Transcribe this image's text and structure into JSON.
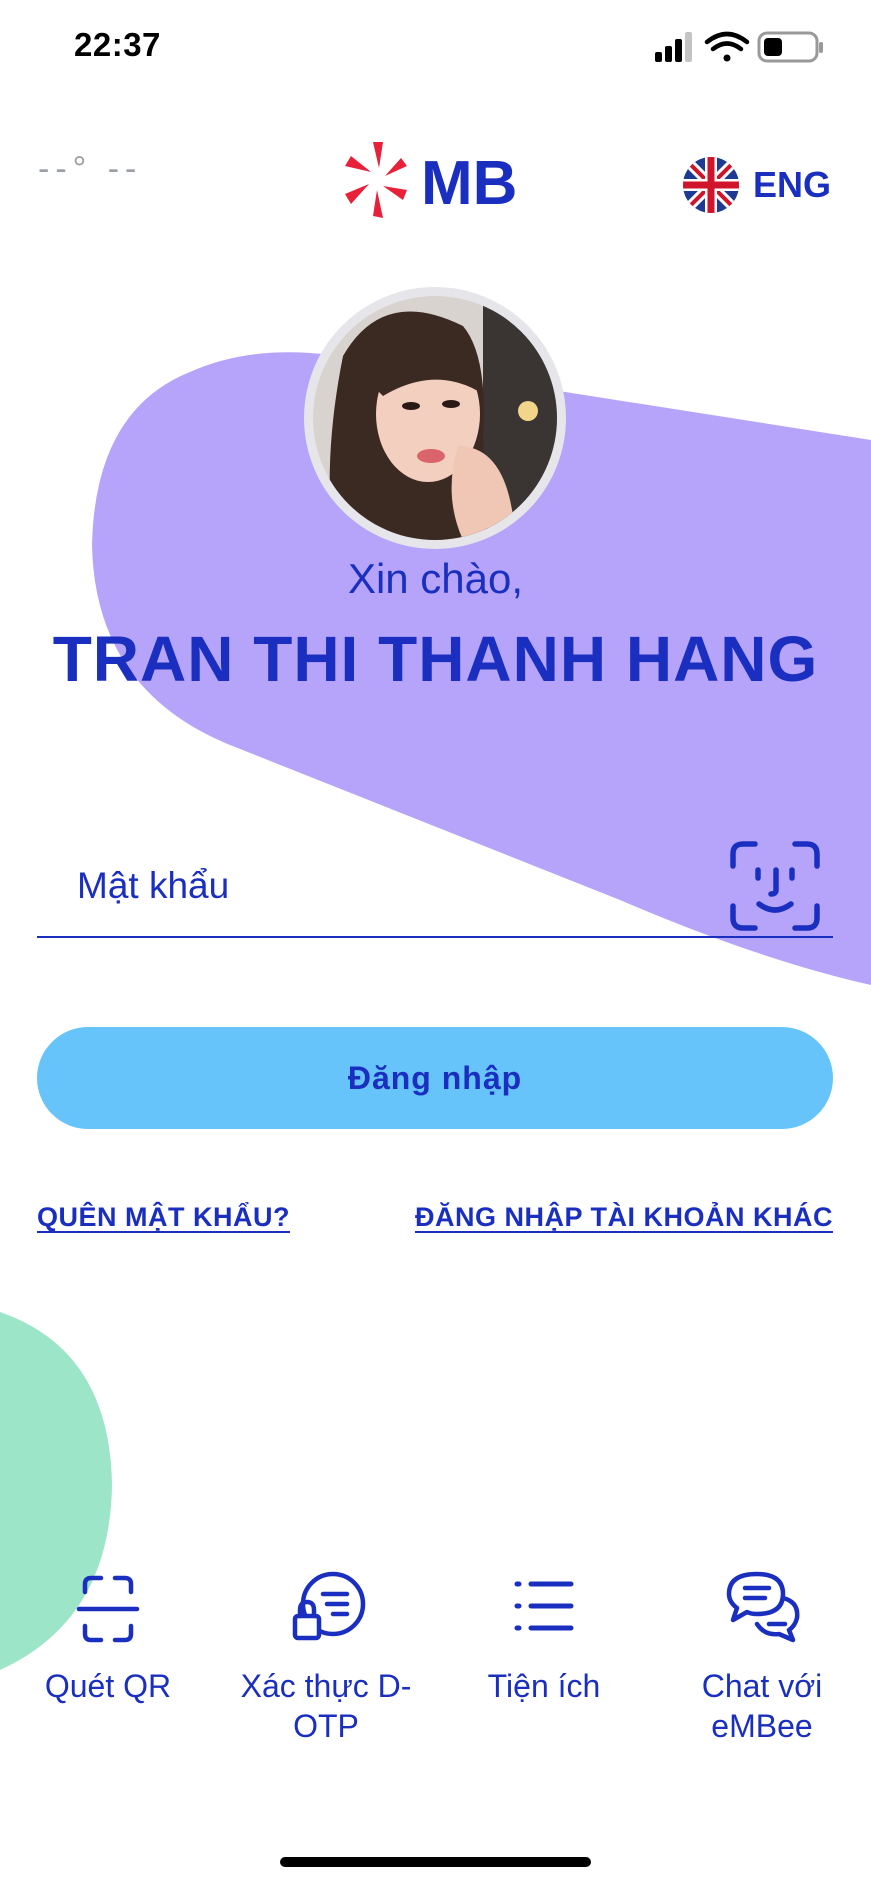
{
  "status_bar": {
    "time": "22:37"
  },
  "header": {
    "weather": "--°  --",
    "logo_text": "MB",
    "language": "ENG"
  },
  "greeting": "Xin chào,",
  "user_name": "TRAN THI THANH HANG",
  "password": {
    "placeholder": "Mật khẩu",
    "value": ""
  },
  "login_button": "Đăng nhập",
  "links": {
    "forgot_password": "QUÊN MẬT KHẨU?",
    "other_account": "ĐĂNG NHẬP TÀI KHOẢN KHÁC"
  },
  "toolbar": [
    {
      "label": "Quét QR",
      "icon": "qr-scan-icon"
    },
    {
      "label": "Xác thực D-OTP",
      "icon": "otp-lock-icon"
    },
    {
      "label": "Tiện ích",
      "icon": "list-icon"
    },
    {
      "label": "Chat với eMBee",
      "icon": "chat-icon"
    }
  ],
  "colors": {
    "brand_blue": "#1a2fbf",
    "purple_blob": "#b6a4fb",
    "green_blob": "#9de5c8",
    "button": "#66c4fb",
    "logo_red": "#e8203a"
  }
}
